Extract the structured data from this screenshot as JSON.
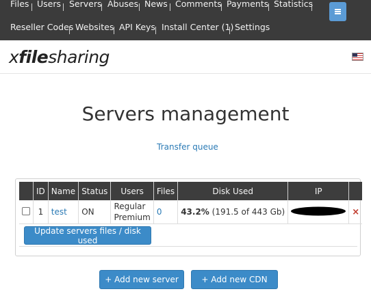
{
  "nav": {
    "row1": [
      "Files",
      "Users",
      "Servers",
      "Abuses",
      "News",
      "Comments",
      "Payments",
      "Statistics"
    ],
    "row2": [
      "Reseller Codes",
      "Websites",
      "API Keys",
      "Install Center (1)",
      "Settings"
    ]
  },
  "header": {
    "logo": {
      "x": "x",
      "files": "file",
      "sharing": "sharing"
    },
    "language_flag": "us-flag-icon"
  },
  "main": {
    "title": "Servers management",
    "transfer_queue_link": "Transfer queue",
    "table": {
      "columns": [
        "",
        "ID",
        "Name",
        "Status",
        "Users",
        "Files",
        "Disk Used",
        "IP",
        ""
      ],
      "rows": [
        {
          "id": "1",
          "name": "test",
          "status": "ON",
          "users_line1": "Regular",
          "users_line2": "Premium",
          "files": "0",
          "disk_percent": "43.2%",
          "disk_detail": "(191.5 of 443 Gb)",
          "ip": "",
          "delete": "×"
        }
      ]
    },
    "update_button": "Update servers files / disk used",
    "add_server_button": "+ Add new server",
    "add_cdn_button": "+ Add new CDN"
  },
  "colors": {
    "nav_bg": "#3b3b3b",
    "accent": "#3c8bc8",
    "link": "#2a7ab5",
    "delete": "#c0392b"
  }
}
